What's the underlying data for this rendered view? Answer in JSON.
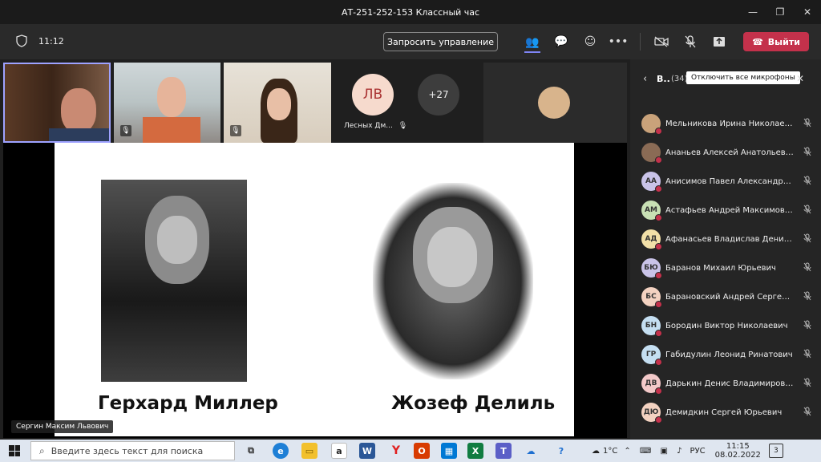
{
  "window": {
    "title": "АТ-251-252-153 Классный час"
  },
  "toolbar": {
    "timer": "11:12",
    "request_control": "Запросить управление",
    "leave": "Выйти"
  },
  "tiles": [
    {
      "name": "",
      "muted": false
    },
    {
      "name": "",
      "muted": true
    },
    {
      "name": "",
      "muted": true
    },
    {
      "initials": "ЛВ",
      "name": "Лесных Дм...",
      "muted": true
    },
    {
      "initials": "+27"
    }
  ],
  "slide": {
    "caption_left": "Герхард Миллер",
    "caption_right": "Жозеф Делиль",
    "presenter": "Сергин Максим Львович"
  },
  "panel": {
    "title": "В..",
    "count": "(34)",
    "mute_all": "Отключить все микрофоны",
    "participants": [
      {
        "initials": "",
        "name": "Мельникова Ирина Николаевна",
        "avatar_color": "#c9a27a"
      },
      {
        "initials": "",
        "name": "Ананьев Алексей Анатольевич",
        "avatar_color": "#8a6b55"
      },
      {
        "initials": "АА",
        "name": "Анисимов Павел Александров...",
        "avatar_color": "#c9c3e8"
      },
      {
        "initials": "АМ",
        "name": "Астафьев Андрей Максимович",
        "avatar_color": "#c8e0b4"
      },
      {
        "initials": "АД",
        "name": "Афанасьев Владислав Денисов...",
        "avatar_color": "#f2e0a8"
      },
      {
        "initials": "БЮ",
        "name": "Баранов Михаил Юрьевич",
        "avatar_color": "#c9c3e8"
      },
      {
        "initials": "БС",
        "name": "Барановский Андрей Сергеевич",
        "avatar_color": "#f3d2c1"
      },
      {
        "initials": "БН",
        "name": "Бородин Виктор Николаевич",
        "avatar_color": "#c5dff2"
      },
      {
        "initials": "ГР",
        "name": "Габидулин Леонид Ринатович",
        "avatar_color": "#c5dff2"
      },
      {
        "initials": "ДВ",
        "name": "Дарькин Денис Владимирович",
        "avatar_color": "#f3c9c9"
      },
      {
        "initials": "ДЮ",
        "name": "Демидкин Сергей Юрьевич",
        "avatar_color": "#f3d2c1"
      }
    ]
  },
  "taskbar": {
    "search_placeholder": "Введите здесь текст для поиска",
    "weather": "1°C",
    "lang": "РУС",
    "time": "11:15",
    "date": "08.02.2022",
    "notif_count": "3"
  }
}
